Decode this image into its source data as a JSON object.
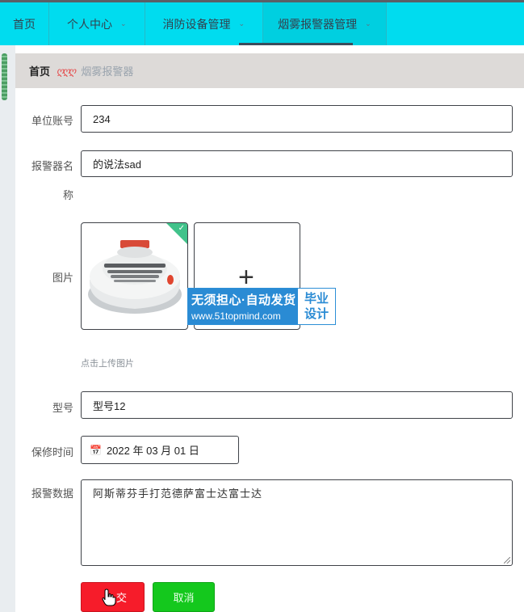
{
  "nav": {
    "items": [
      {
        "label": "首页",
        "has_dropdown": false
      },
      {
        "label": "个人中心",
        "has_dropdown": true
      },
      {
        "label": "消防设备管理",
        "has_dropdown": true
      },
      {
        "label": "烟雾报警器管理",
        "has_dropdown": true
      }
    ],
    "active_index": 3,
    "colors": {
      "bar": "#00dcef",
      "text": "#33414e"
    }
  },
  "breadcrumb": {
    "home": "首页",
    "separator": "ღღღ",
    "current": "烟雾报警器"
  },
  "form": {
    "unit_account": {
      "label": "单位账号",
      "value": "234"
    },
    "alarm_name": {
      "label_line1": "报警器名",
      "label_line2": "称",
      "value": "的说法sad"
    },
    "image": {
      "label": "图片",
      "hint": "点击上传图片",
      "upload_icon": "plus-icon",
      "uploaded_image": "smoke-detector-photo"
    },
    "model": {
      "label": "型号",
      "value": "型号12"
    },
    "warranty": {
      "label": "保修时间",
      "value": "2022 年 03 月 01 日",
      "icon": "calendar-icon"
    },
    "alarm_data": {
      "label": "报警数据",
      "value": "阿斯蒂芬手打范德萨富士达富士达"
    }
  },
  "buttons": {
    "submit": "交",
    "cancel": "取消"
  },
  "watermark": {
    "line1": "无须担心·自动发货",
    "line2": "www.51topmind.com",
    "right1": "毕业",
    "right2": "设计"
  }
}
